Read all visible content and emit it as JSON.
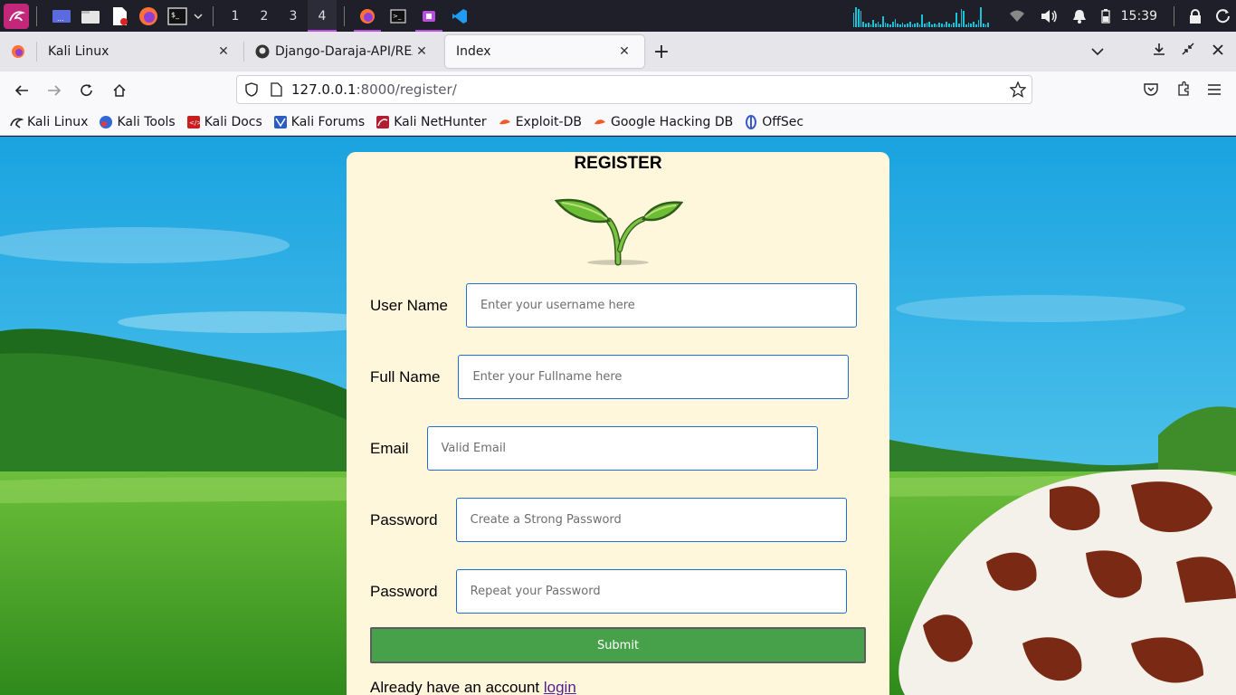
{
  "taskbar": {
    "workspaces": [
      "1",
      "2",
      "3",
      "4"
    ],
    "active_workspace": "4",
    "clock": "15:39",
    "accent": "#b94fe0",
    "cpu_color": "#19c2d6"
  },
  "tabs": [
    {
      "label": "Kali Linux",
      "icon": "firefox-icon"
    },
    {
      "label": "Django-Daraja-API/READI",
      "icon": "github-icon"
    },
    {
      "label": "Index",
      "icon": "",
      "active": true
    }
  ],
  "url": {
    "host": "127.0.0.1",
    "path": ":8000/register/"
  },
  "bookmarks": [
    {
      "label": "Kali Linux",
      "icon": "kali-dragon-icon"
    },
    {
      "label": "Kali Tools",
      "icon": "kali-tools-icon"
    },
    {
      "label": "Kali Docs",
      "icon": "kali-docs-icon"
    },
    {
      "label": "Kali Forums",
      "icon": "kali-forums-icon"
    },
    {
      "label": "Kali NetHunter",
      "icon": "kali-nethunter-icon"
    },
    {
      "label": "Exploit-DB",
      "icon": "exploit-db-icon"
    },
    {
      "label": "Google Hacking DB",
      "icon": "google-hacking-db-icon"
    },
    {
      "label": "OffSec",
      "icon": "offsec-icon"
    }
  ],
  "form": {
    "title": "REGISTER",
    "fields": [
      {
        "label": "User Name",
        "placeholder": "Enter your username here",
        "value": ""
      },
      {
        "label": "Full Name",
        "placeholder": "Enter your Fullname here",
        "value": ""
      },
      {
        "label": "Email",
        "placeholder": "Valid Email",
        "value": ""
      },
      {
        "label": "Password",
        "placeholder": "Create a Strong Password",
        "value": ""
      },
      {
        "label": "Password",
        "placeholder": "Repeat your Password",
        "value": ""
      }
    ],
    "submit_label": "Submit",
    "already_text": "Already have an account",
    "login_link": "login",
    "submit_color": "#47a14a",
    "card_color": "#fff7dc"
  }
}
